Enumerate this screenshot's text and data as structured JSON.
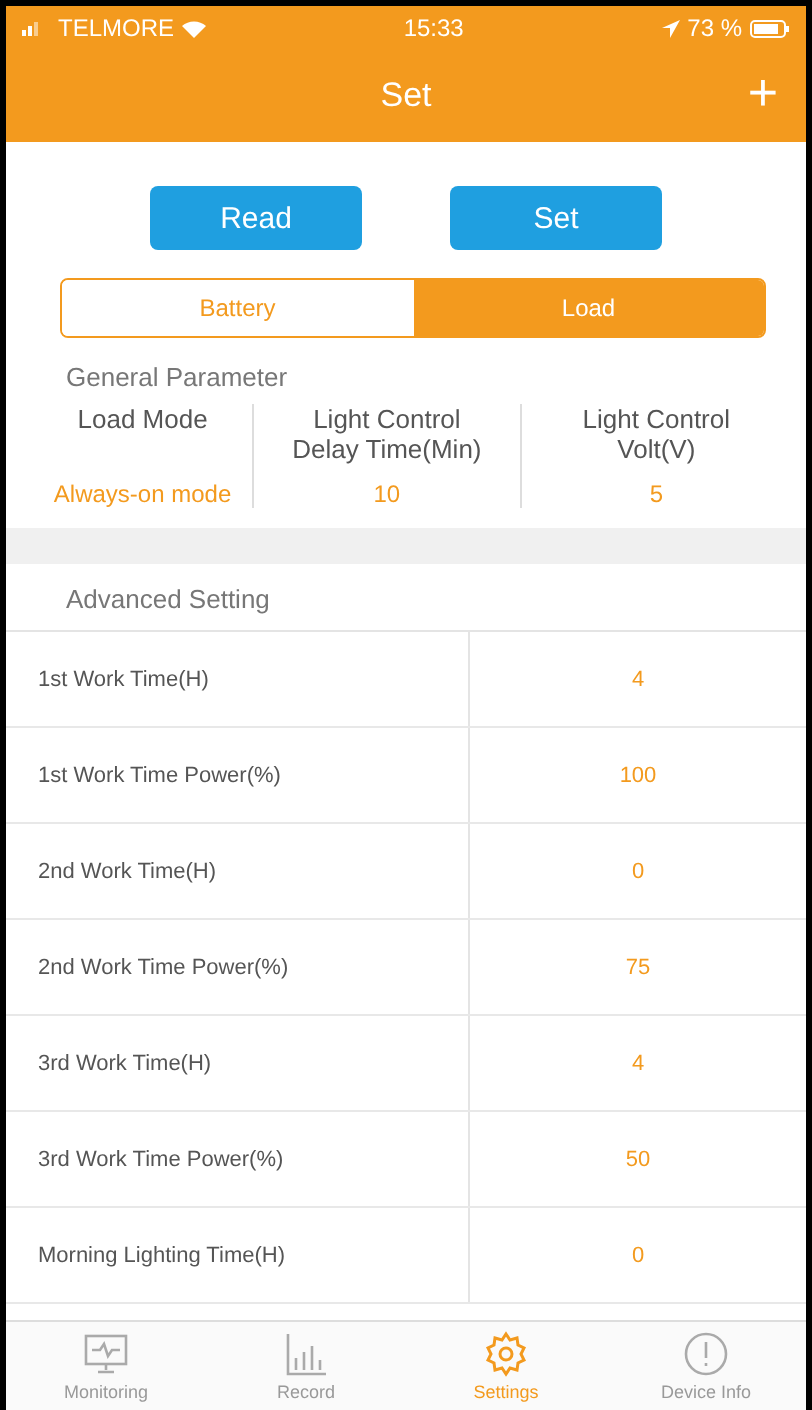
{
  "status_bar": {
    "carrier": "TELMORE",
    "time": "15:33",
    "battery": "73 %"
  },
  "nav": {
    "title": "Set",
    "add": "+"
  },
  "actions": [
    "Read",
    "Set"
  ],
  "segments": [
    {
      "label": "Battery",
      "selected": false
    },
    {
      "label": "Load",
      "selected": true
    }
  ],
  "general": {
    "title": "General Parameter",
    "params": [
      {
        "label": "Load Mode",
        "value": "Always-on mode"
      },
      {
        "label": "Light Control Delay Time(Min)",
        "value": "10"
      },
      {
        "label": "Light Control Volt(V)",
        "value": "5"
      }
    ]
  },
  "advanced": {
    "title": "Advanced Setting",
    "rows": [
      {
        "label": "1st Work Time(H)",
        "value": "4"
      },
      {
        "label": "1st Work Time Power(%)",
        "value": "100"
      },
      {
        "label": "2nd Work Time(H)",
        "value": "0"
      },
      {
        "label": "2nd Work Time Power(%)",
        "value": "75"
      },
      {
        "label": "3rd Work Time(H)",
        "value": "4"
      },
      {
        "label": "3rd Work Time Power(%)",
        "value": "50"
      },
      {
        "label": "Morning Lighting Time(H)",
        "value": "0"
      }
    ]
  },
  "tab_bar": [
    {
      "label": "Monitoring",
      "kind": "monitor",
      "selected": false
    },
    {
      "label": "Record",
      "kind": "chart",
      "selected": false
    },
    {
      "label": "Settings",
      "kind": "gear",
      "selected": true
    },
    {
      "label": "Device Info",
      "kind": "info",
      "selected": false
    }
  ]
}
